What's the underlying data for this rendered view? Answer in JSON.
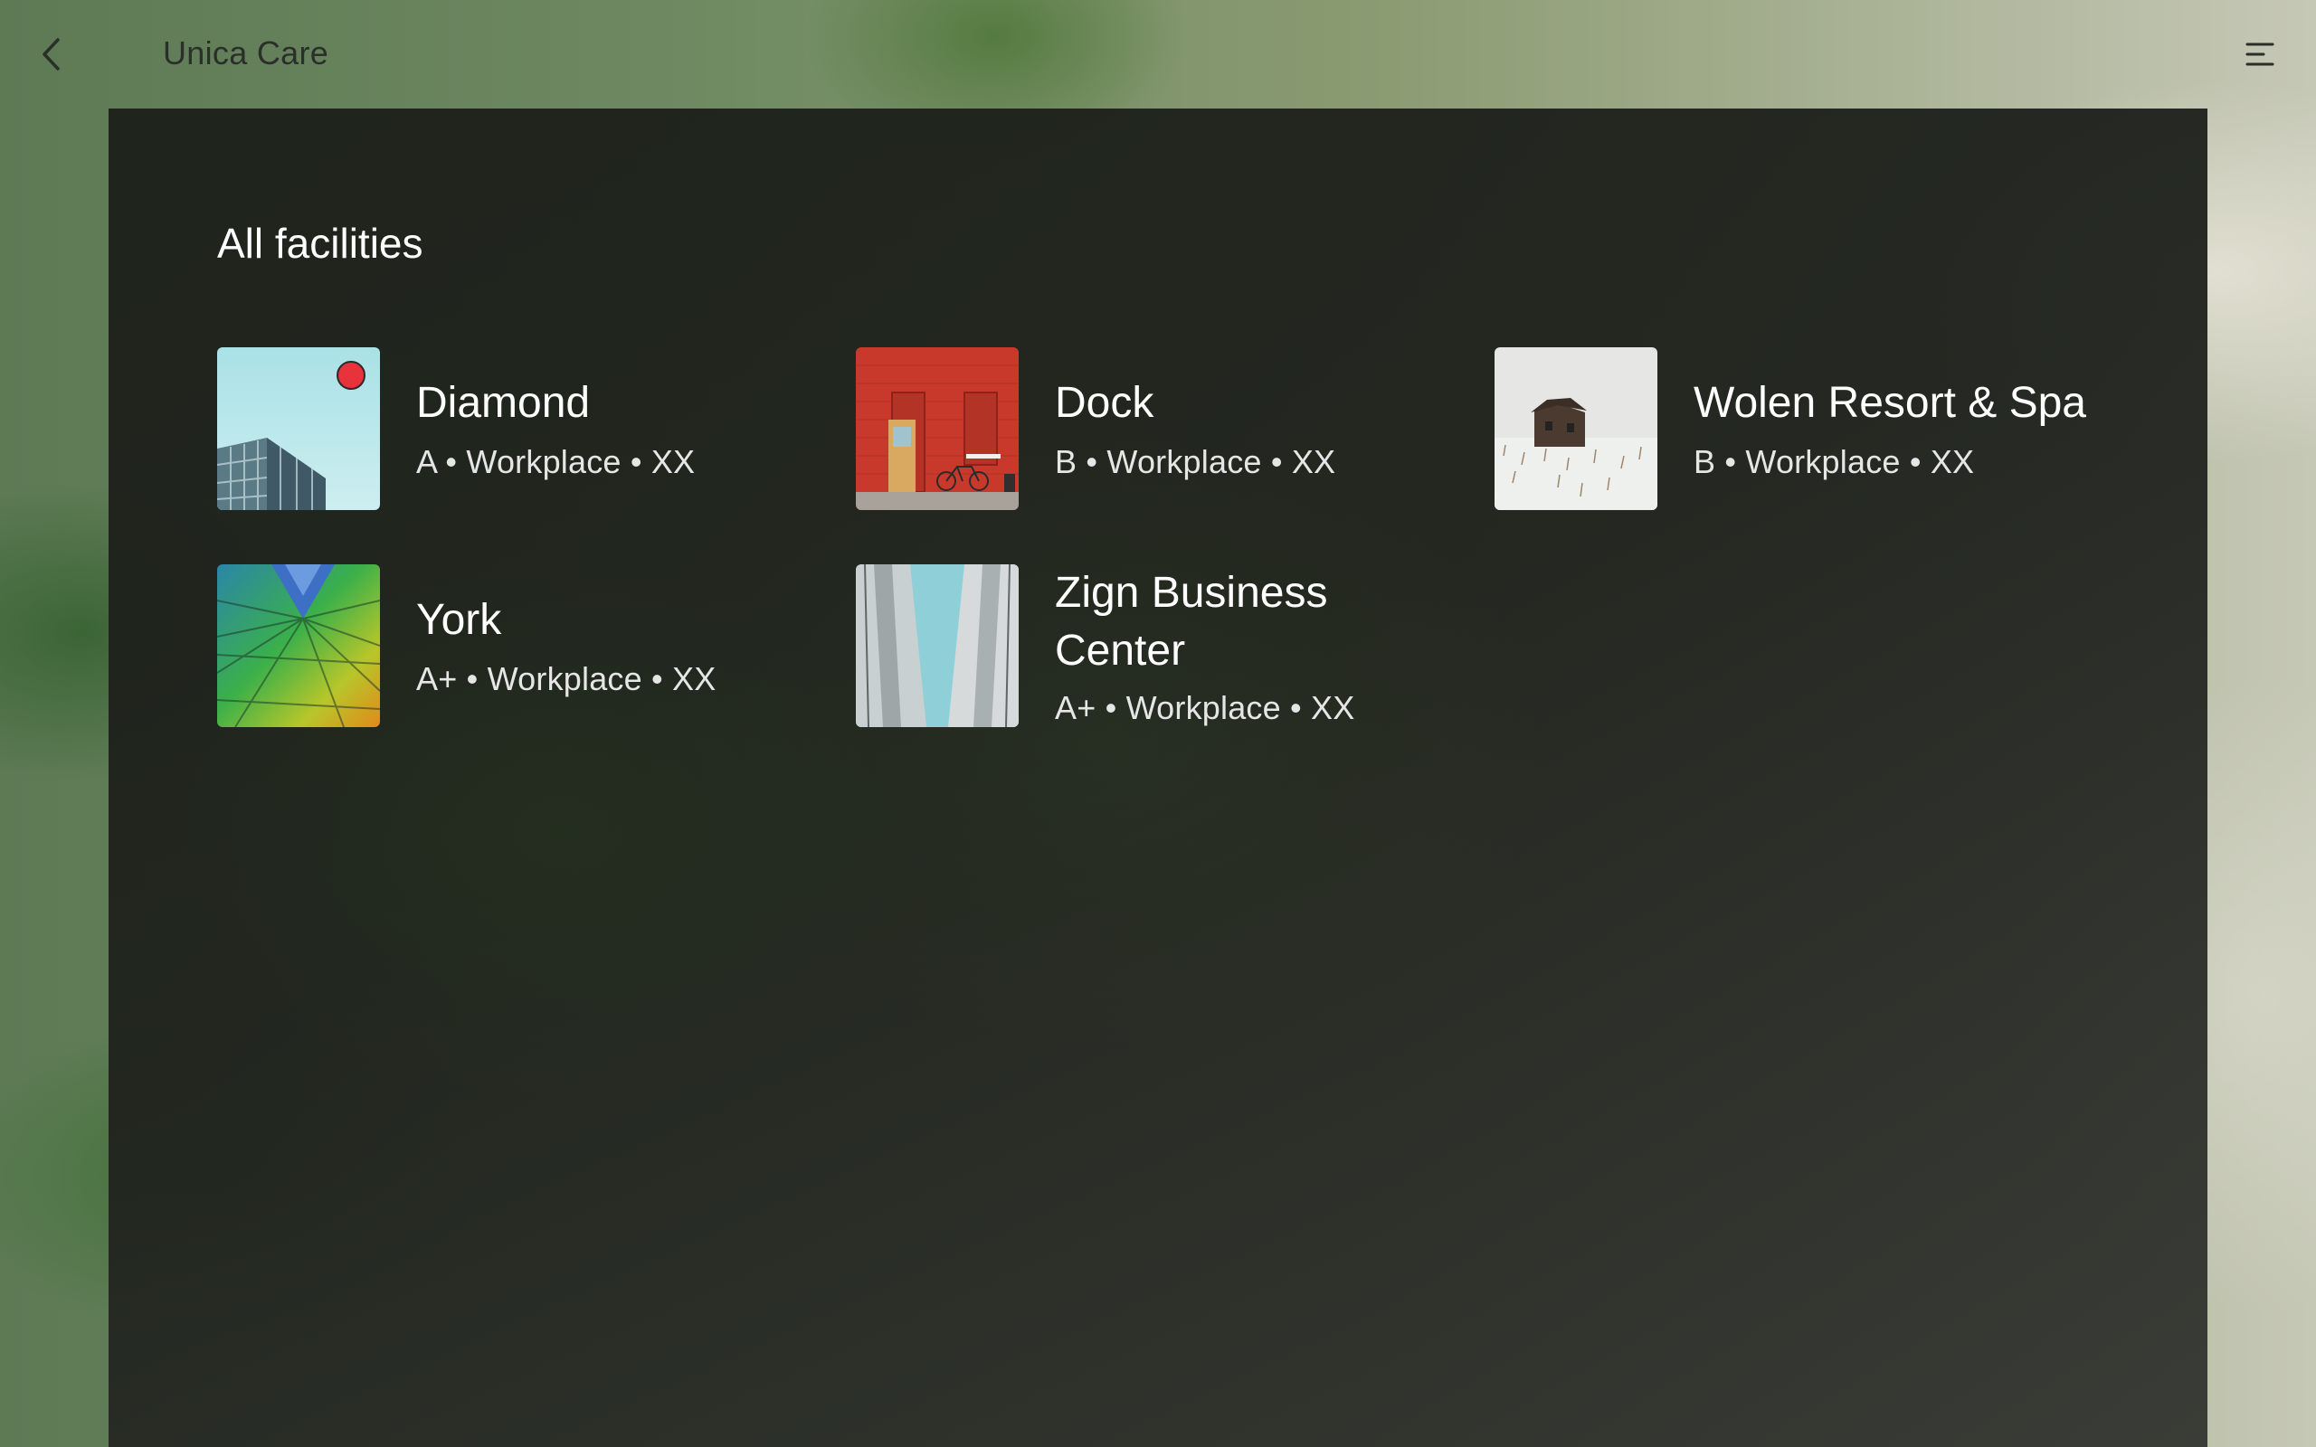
{
  "header": {
    "app_title": "Unica Care",
    "back_icon": "chevron-left-icon",
    "menu_icon": "menu-icon"
  },
  "main": {
    "section_title": "All facilities",
    "facilities": [
      {
        "name": "Diamond",
        "meta": "A • Workplace • XX",
        "image": "glass-building-sky",
        "status_badge_color": "#e8323c"
      },
      {
        "name": "Dock",
        "meta": "B • Workplace • XX",
        "image": "red-brick-wall-bicycle"
      },
      {
        "name": "Wolen Resort & Spa",
        "meta": "B • Workplace • XX",
        "image": "barn-snowy-field"
      },
      {
        "name": "York",
        "meta": "A+ • Workplace • XX",
        "image": "colorful-facade"
      },
      {
        "name": "Zign Business Center",
        "meta": "A+ • Workplace • XX",
        "image": "tall-buildings-perspective"
      }
    ]
  }
}
